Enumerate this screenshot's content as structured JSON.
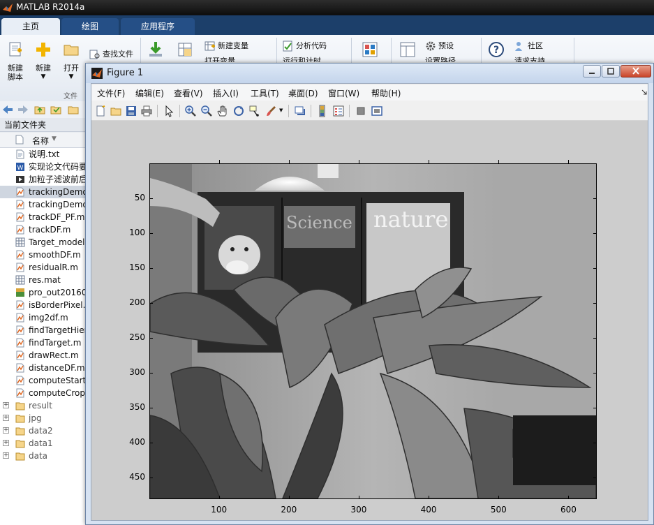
{
  "app": {
    "title": "MATLAB R2014a"
  },
  "tabs": [
    {
      "label": "主页"
    },
    {
      "label": "绘图"
    },
    {
      "label": "应用程序"
    }
  ],
  "ribbon": {
    "new_script": "新建\n脚本",
    "new": "新建",
    "open": "打开",
    "find_files": "查找文件",
    "new_variable": "新建变量",
    "open_variable": "打开变量",
    "analyze_code": "分析代码",
    "run_and_time": "运行和计时",
    "preferences": "预设",
    "set_path": "设置路径",
    "community": "社区",
    "request_support": "请求支持",
    "file_group": "文件"
  },
  "current_folder": {
    "title": "当前文件夹",
    "column_name": "名称",
    "files": [
      {
        "name": "说明.txt",
        "type": "txt"
      },
      {
        "name": "实现论文代码要",
        "type": "doc"
      },
      {
        "name": "加粒子滤波前后",
        "type": "vid"
      },
      {
        "name": "trackingDemo",
        "type": "m",
        "selected": true
      },
      {
        "name": "trackingDemo",
        "type": "m"
      },
      {
        "name": "trackDF_PF.m",
        "type": "m"
      },
      {
        "name": "trackDF.m",
        "type": "m"
      },
      {
        "name": "Target_model",
        "type": "mat"
      },
      {
        "name": "smoothDF.m",
        "type": "m"
      },
      {
        "name": "residualR.m",
        "type": "m"
      },
      {
        "name": "res.mat",
        "type": "mat"
      },
      {
        "name": "pro_out20160",
        "type": "img"
      },
      {
        "name": "isBorderPixel.",
        "type": "m"
      },
      {
        "name": "img2df.m",
        "type": "m"
      },
      {
        "name": "findTargetHier",
        "type": "m"
      },
      {
        "name": "findTarget.m",
        "type": "m"
      },
      {
        "name": "drawRect.m",
        "type": "m"
      },
      {
        "name": "distanceDF.m",
        "type": "m"
      },
      {
        "name": "computeStarti",
        "type": "m"
      },
      {
        "name": "computeCrop",
        "type": "m"
      },
      {
        "name": "result",
        "type": "folder"
      },
      {
        "name": "jpg",
        "type": "folder"
      },
      {
        "name": "data2",
        "type": "folder"
      },
      {
        "name": "data1",
        "type": "folder"
      },
      {
        "name": "data",
        "type": "folder"
      }
    ]
  },
  "figure": {
    "title": "Figure 1",
    "menus": [
      "文件(F)",
      "编辑(E)",
      "查看(V)",
      "插入(I)",
      "工具(T)",
      "桌面(D)",
      "窗口(W)",
      "帮助(H)"
    ],
    "y_ticks": [
      50,
      100,
      150,
      200,
      250,
      300,
      350,
      400,
      450
    ],
    "x_ticks": [
      100,
      200,
      300,
      400,
      500,
      600
    ],
    "x_range": [
      0.5,
      640.5
    ],
    "y_range": [
      0.5,
      480.5
    ],
    "image_text": {
      "sign1": "Science",
      "sign2": "nature"
    }
  },
  "colors": {
    "tab_active_bg": "#e8eef6",
    "tab_bg": "#254f86",
    "tabbar_bg": "#1c3f6a",
    "selected_row": "#cfd6e0"
  }
}
